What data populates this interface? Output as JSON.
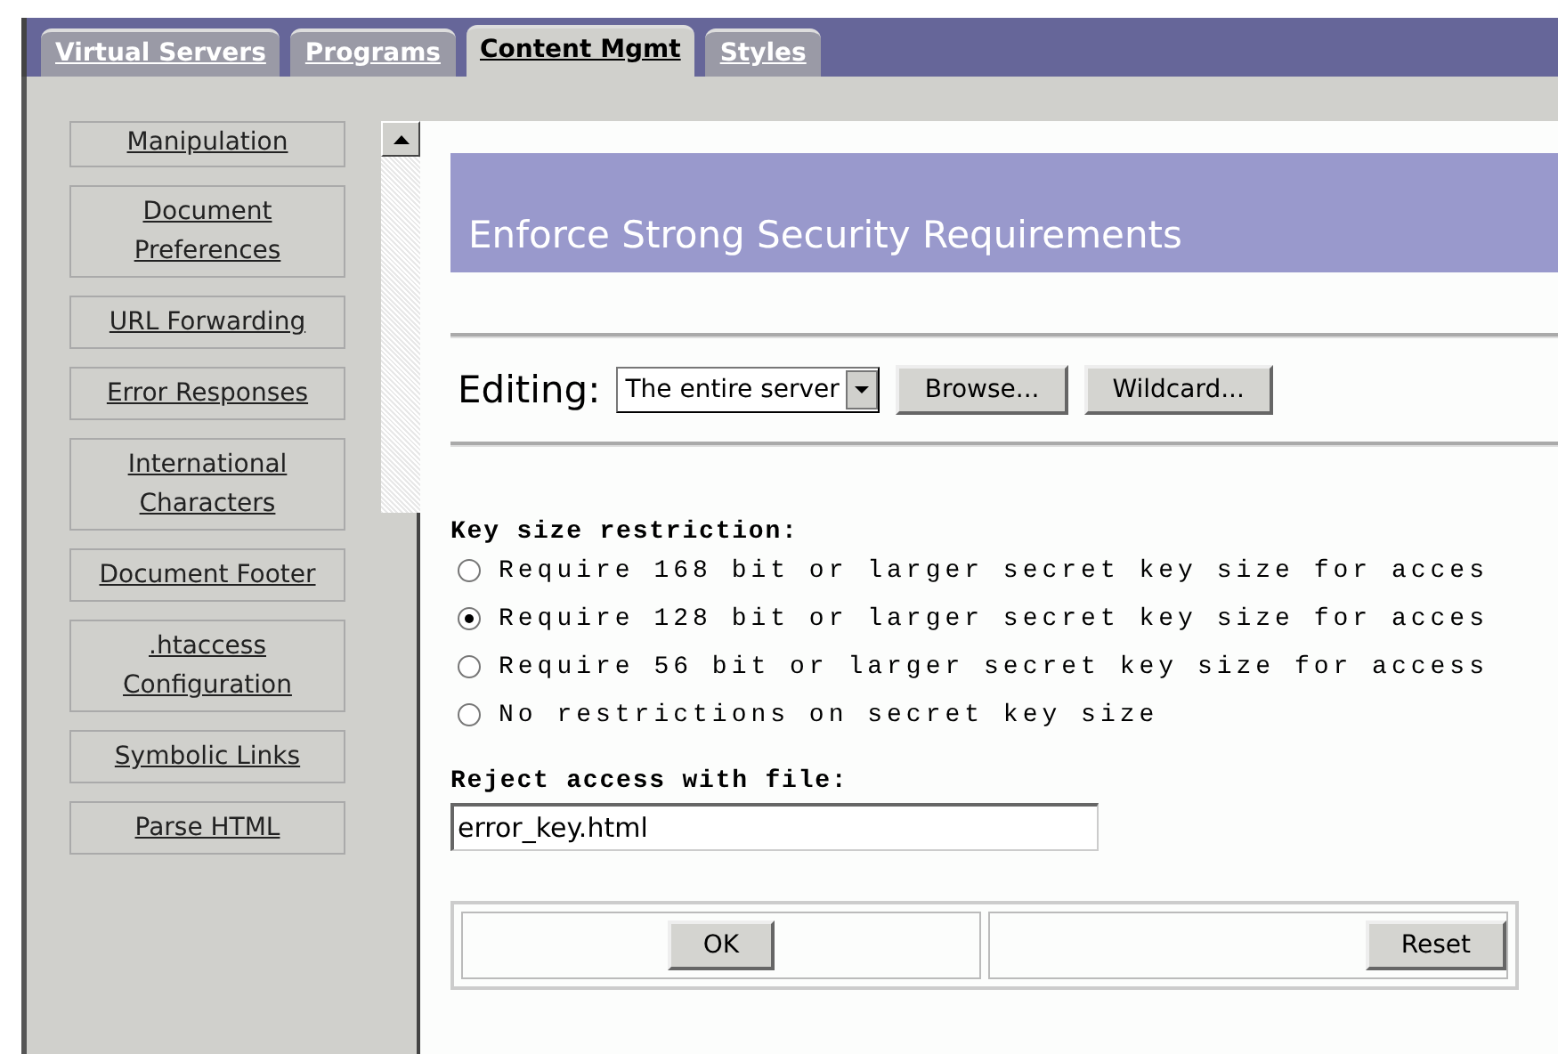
{
  "tabs": [
    {
      "label": "Virtual Servers",
      "selected": false
    },
    {
      "label": "Programs",
      "selected": false
    },
    {
      "label": "Content Mgmt",
      "selected": true
    },
    {
      "label": "Styles",
      "selected": false
    }
  ],
  "sidebar": {
    "items": [
      {
        "label": "Manipulation"
      },
      {
        "label": "Document Preferences"
      },
      {
        "label": "URL Forwarding"
      },
      {
        "label": "Error Responses"
      },
      {
        "label": "International Characters"
      },
      {
        "label": "Document Footer"
      },
      {
        "label": ".htaccess Configuration"
      },
      {
        "label": "Symbolic Links"
      },
      {
        "label": "Parse HTML"
      }
    ]
  },
  "page_title": "Enforce Strong Security Requirements",
  "editing": {
    "label": "Editing:",
    "select_value": "The entire server",
    "buttons": [
      "Browse...",
      "Wildcard..."
    ]
  },
  "key_size": {
    "label": "Key size restriction:",
    "options": [
      {
        "label": "Require 168 bit or larger secret key size for acces",
        "selected": false
      },
      {
        "label": "Require 128 bit or larger secret key size for acces",
        "selected": true
      },
      {
        "label": "Require 56 bit or larger secret key size for access",
        "selected": false
      },
      {
        "label": "No restrictions on secret key size",
        "selected": false
      }
    ]
  },
  "reject": {
    "label": "Reject access with file:",
    "value": "error_key.html"
  },
  "buttons": [
    "OK",
    "Reset"
  ]
}
